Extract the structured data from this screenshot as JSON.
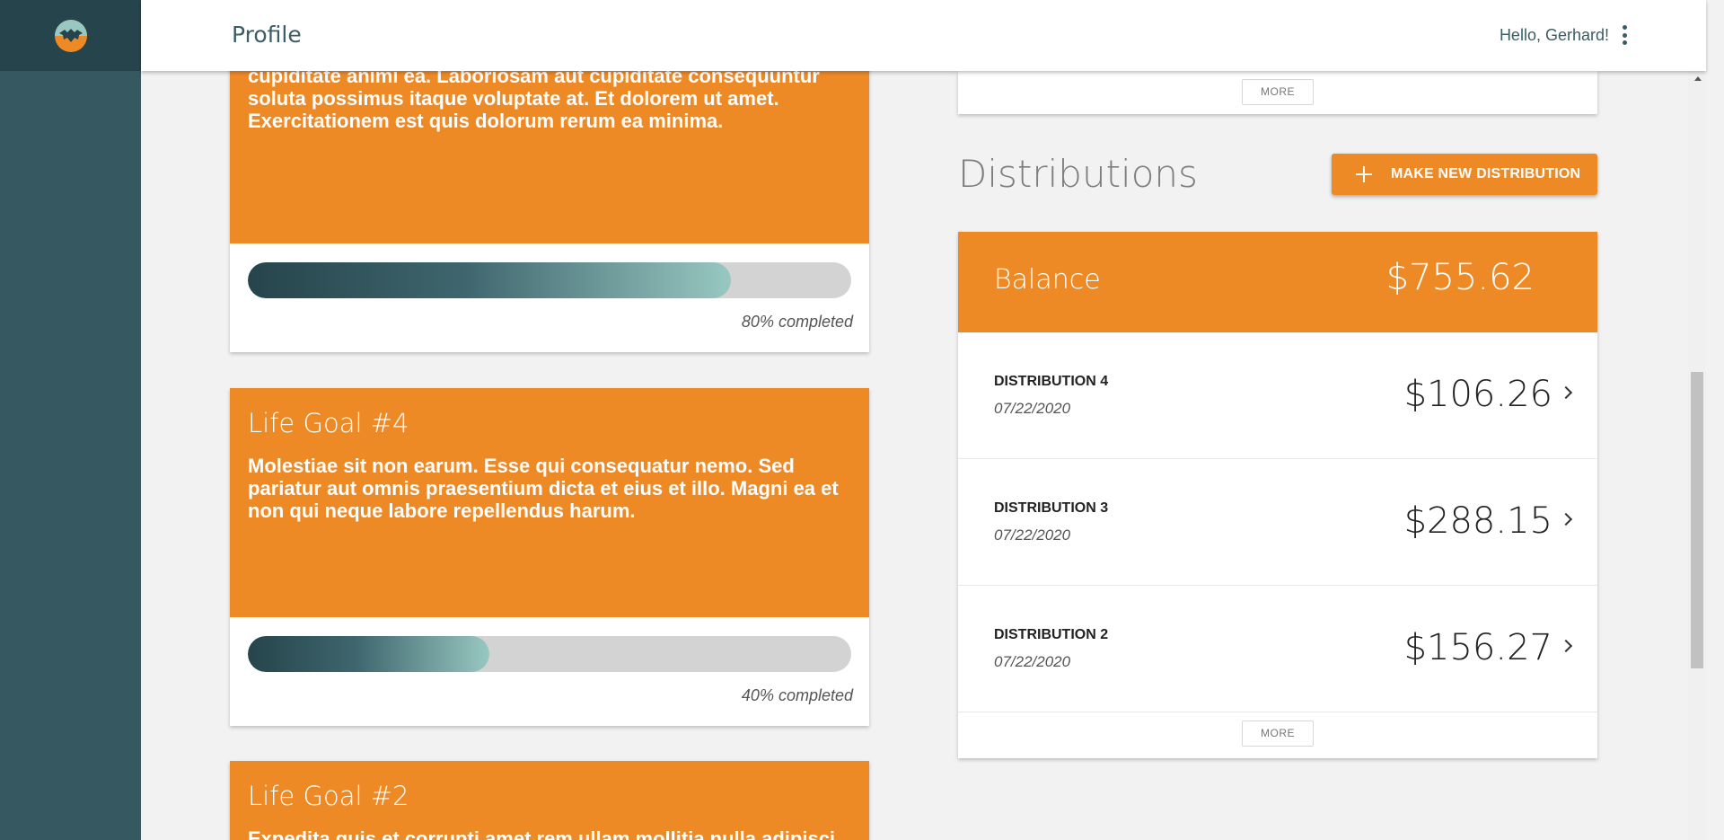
{
  "header": {
    "title": "Profile",
    "greeting": "Hello, Gerhard!"
  },
  "goals": [
    {
      "title": "",
      "description": "cupiditate animi ea. Laboriosam aut cupiditate consequuntur soluta possimus itaque voluptate at. Et dolorem ut amet. Exercitationem est quis dolorum rerum ea minima.",
      "progress_percent": 80,
      "progress_label": "80% completed"
    },
    {
      "title": "Life Goal #4",
      "description": "Molestiae sit non earum. Esse qui consequatur nemo. Sed pariatur aut omnis praesentium dicta et eius et illo. Magni ea et non qui neque labore repellendus harum.",
      "progress_percent": 40,
      "progress_label": "40% completed"
    },
    {
      "title": "Life Goal #2",
      "description": "Expedita quis et corrupti amet rem ullam mollitia nulla adipisci.",
      "progress_percent": 0,
      "progress_label": ""
    }
  ],
  "top_card": {
    "more_label": "MORE"
  },
  "distributions": {
    "heading": "Distributions",
    "make_button_label": "MAKE NEW DISTRIBUTION",
    "balance_label": "Balance",
    "balance_value": "$755.62",
    "items": [
      {
        "name": "DISTRIBUTION 4",
        "date": "07/22/2020",
        "amount": "$106.26"
      },
      {
        "name": "DISTRIBUTION 3",
        "date": "07/22/2020",
        "amount": "$288.15"
      },
      {
        "name": "DISTRIBUTION 2",
        "date": "07/22/2020",
        "amount": "$156.27"
      }
    ],
    "more_label": "MORE"
  },
  "colors": {
    "accent": "#ee8a26",
    "sidebar": "#365861",
    "sidebar_dark": "#26444b"
  },
  "icons": {
    "logo": "bat-logo-icon",
    "menu": "kebab-menu-icon",
    "add": "plus-icon",
    "row": "chevron-right-icon"
  }
}
